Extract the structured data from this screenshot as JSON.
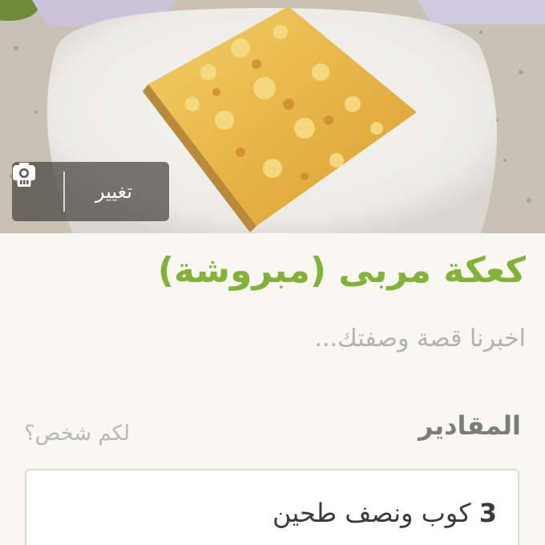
{
  "photo": {
    "alt_subject": "",
    "change_label": "تغيير",
    "icons": {
      "delete": "trash-icon",
      "change": "camera-icon"
    }
  },
  "recipe": {
    "title": "كعكة مربى (مبروشة)",
    "story_placeholder": "اخبرنا قصة وصفتك..."
  },
  "ingredients": {
    "heading": "المقادير",
    "servings_placeholder": "لكم شخص؟",
    "items": [
      {
        "quantity": "3",
        "text": "كوب ونصف طحين"
      }
    ]
  },
  "colors": {
    "title_green": "#82b236",
    "placeholder_gray": "#b3b3ae",
    "heading_gray": "#7c7c78",
    "background": "#f8f7f2"
  }
}
